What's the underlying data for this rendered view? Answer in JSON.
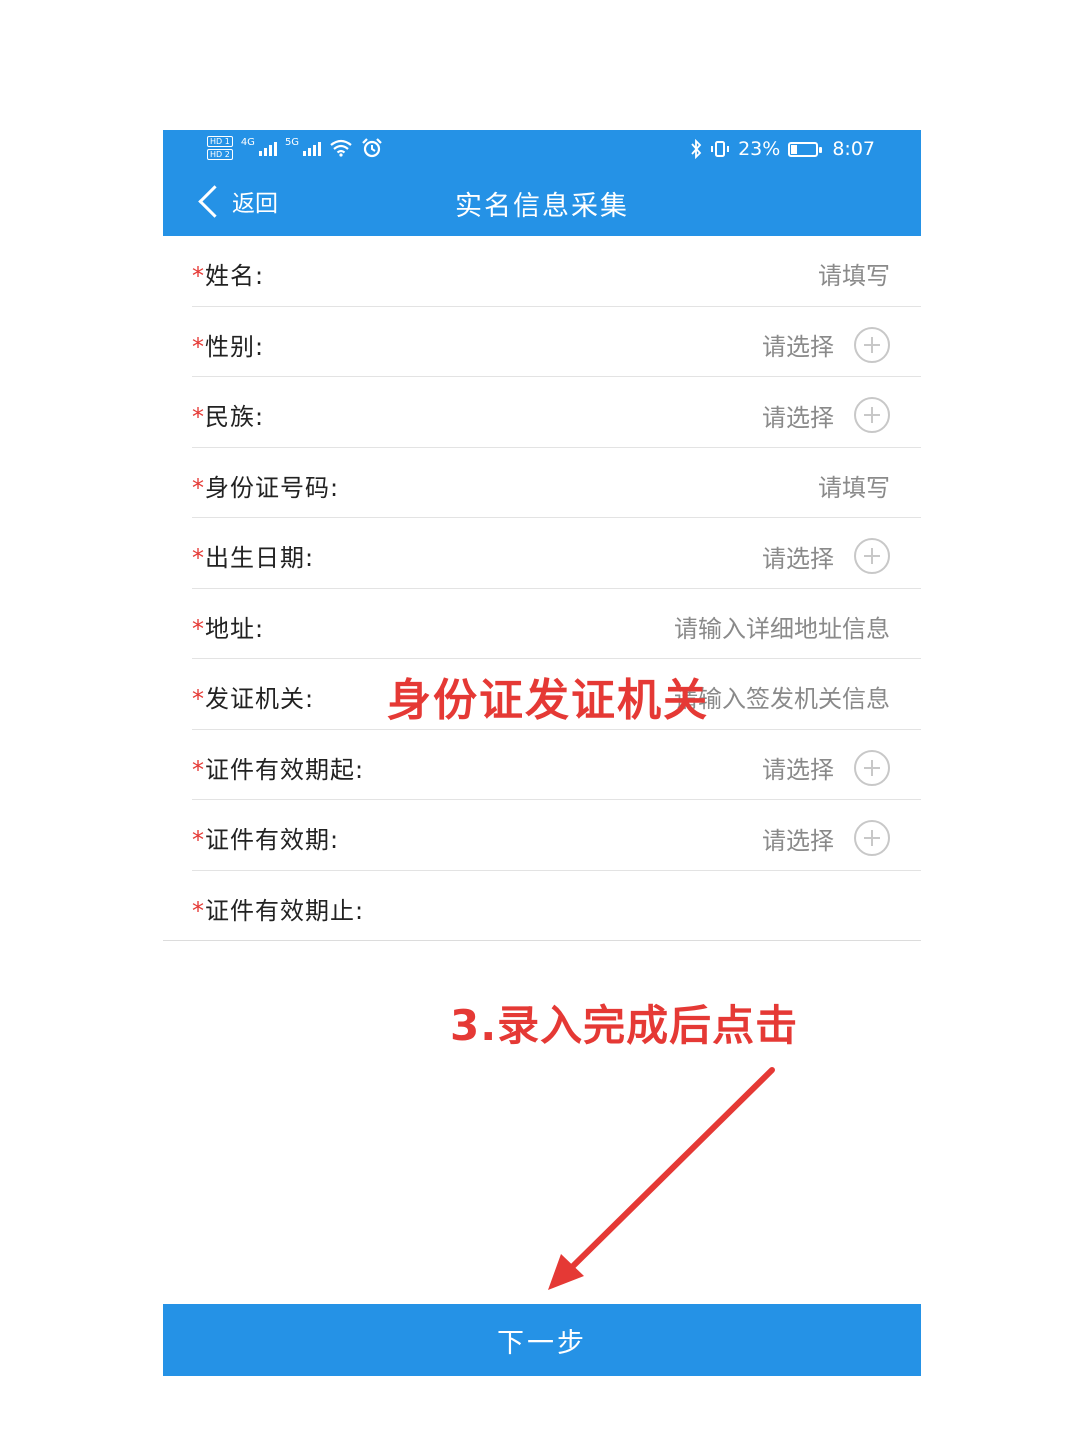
{
  "status_bar": {
    "sim1": "HD 1",
    "sim2": "HD 2",
    "net1": "4G",
    "net2": "5G",
    "battery": "23%",
    "time": "8:07"
  },
  "header": {
    "back_label": "返回",
    "title": "实名信息采集"
  },
  "form": {
    "rows": [
      {
        "label": "姓名:",
        "value": "请填写"
      },
      {
        "label": "性别:",
        "value": "请选择"
      },
      {
        "label": "民族:",
        "value": "请选择"
      },
      {
        "label": "身份证号码:",
        "value": "请填写"
      },
      {
        "label": "出生日期:",
        "value": "请选择"
      },
      {
        "label": "地址:",
        "value": "请输入详细地址信息"
      },
      {
        "label": "发证机关:",
        "value": "请输入签发机关信息"
      },
      {
        "label": "证件有效期起:",
        "value": "请选择"
      },
      {
        "label": "证件有效期:",
        "value": "请选择"
      },
      {
        "label": "证件有效期止:",
        "value": ""
      }
    ],
    "required_mark": "*"
  },
  "annotations": {
    "issuer_note": "身份证发证机关",
    "step_note": "3.录入完成后点击"
  },
  "footer": {
    "next_label": "下一步"
  },
  "colors": {
    "brand_blue": "#2592e6",
    "annotation_red": "#e53935"
  }
}
